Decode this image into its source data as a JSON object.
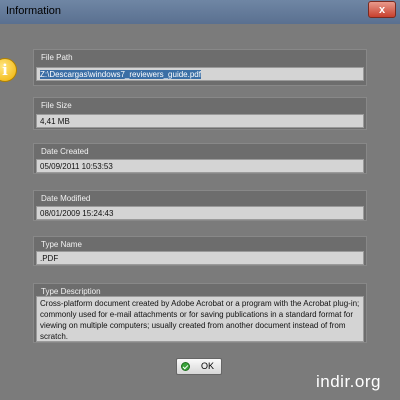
{
  "window": {
    "title": "Information",
    "close_label": "x"
  },
  "fields": [
    {
      "label": "File Path",
      "value": "Z:\\Descargas\\windows7_reviewers_guide.pdf"
    },
    {
      "label": "File Size",
      "value": "4,41 MB"
    },
    {
      "label": "Date Created",
      "value": "05/09/2011 10:53:53"
    },
    {
      "label": "Date Modified",
      "value": "08/01/2009 15:24:43"
    },
    {
      "label": "Type Name",
      "value": ".PDF"
    },
    {
      "label": "Type Description",
      "value": "Cross-platform document created by Adobe Acrobat or a program with the Acrobat plug-in; commonly used for e-mail attachments or for saving publications in a standard format for viewing on multiple computers; usually created from another document instead of from scratch."
    }
  ],
  "buttons": {
    "ok_label": "OK"
  },
  "icons": {
    "info": "info-icon",
    "ok": "check-icon",
    "close": "close-icon"
  },
  "watermark": "indir.org"
}
